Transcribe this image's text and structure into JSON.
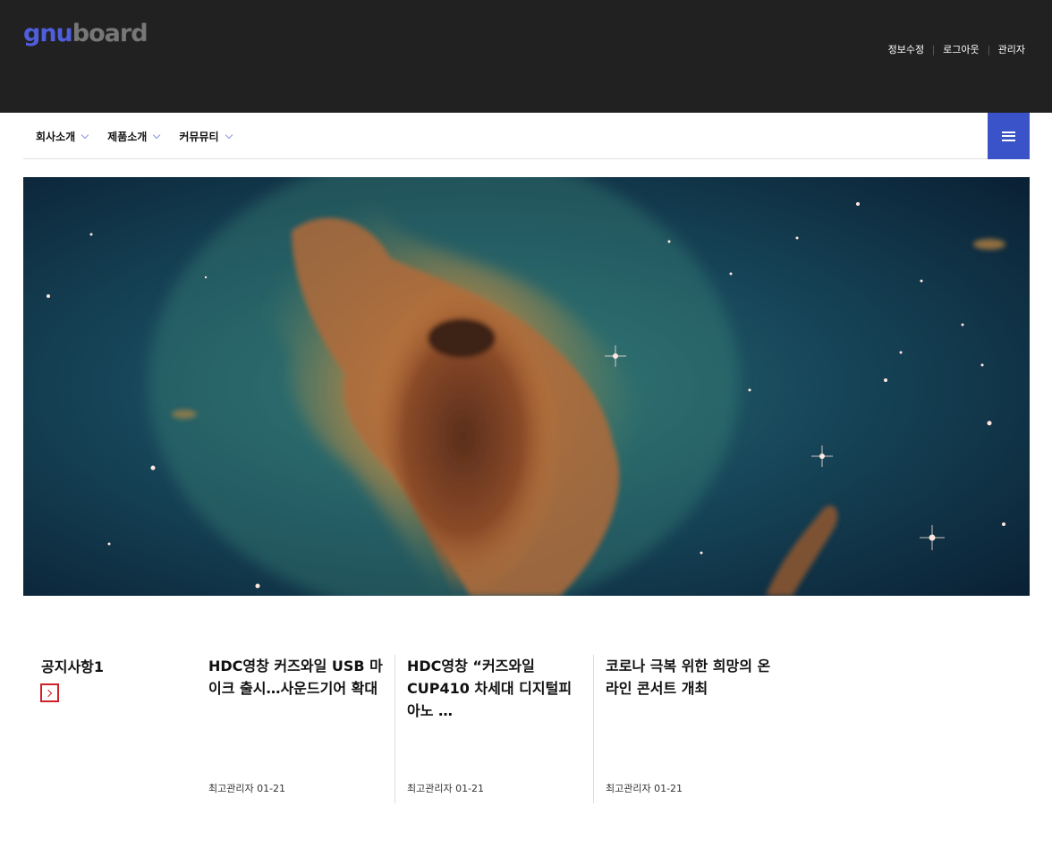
{
  "header": {
    "logo": {
      "part1": "gnu",
      "part2": "board"
    },
    "links": [
      {
        "label": "정보수정"
      },
      {
        "label": "로그아웃"
      },
      {
        "label": "관리자"
      }
    ]
  },
  "gnb": {
    "items": [
      {
        "label": "회사소개"
      },
      {
        "label": "제품소개"
      },
      {
        "label": "커뮤뮤티"
      }
    ],
    "allmenu_icon": "hamburger-icon"
  },
  "hero": {
    "image": "nebula-photo"
  },
  "latest": {
    "title": "공지사항1",
    "more_icon": "chevron-right-icon",
    "posts": [
      {
        "subject": "HDC영창 커즈와일 USB 마이크 출시…사운드기어 확대",
        "info": "최고관리자 01-21"
      },
      {
        "subject": "HDC영창 “커즈와일 CUP410 차세대 디지털피아노 …",
        "info": "최고관리자 01-21"
      },
      {
        "subject": "코로나 극복 위한 희망의 온라인 콘서트 개최",
        "info": "최고관리자 01-21"
      }
    ]
  },
  "colors": {
    "header_bg": "#212121",
    "accent": "#3a53c9",
    "logo_gnu": "#4f5edc",
    "logo_board": "#777777",
    "more_border": "#d0202a"
  }
}
